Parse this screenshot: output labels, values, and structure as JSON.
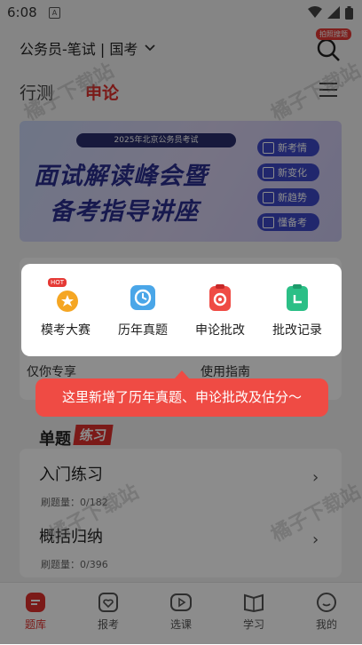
{
  "status": {
    "time": "6:08",
    "app_icon_letter": "A"
  },
  "header": {
    "exam_selector": "公务员-笔试 | 国考",
    "search_badge": "拍照搜题",
    "tabs": [
      "行测",
      "申论"
    ],
    "active_tab": "申论"
  },
  "banner": {
    "subtitle": "2025年北京公务员考试",
    "title_line1": "面试解读峰会暨",
    "title_line2": "备考指导讲座",
    "chips": [
      "新考情",
      "新变化",
      "新趋势",
      "懂备考"
    ]
  },
  "background": {
    "entry_left": "仅你专享",
    "entry_right": "使用指南",
    "section_title": "单题",
    "section_tag": "练习",
    "items": [
      {
        "title": "入门练习",
        "sub": "刷题量：0/182"
      },
      {
        "title": "概括归纳",
        "sub": "刷题量：0/396"
      }
    ]
  },
  "popup": {
    "features": [
      {
        "label": "模考大赛",
        "icon": "trophy-hot-icon",
        "badge": "HOT"
      },
      {
        "label": "历年真题",
        "icon": "history-icon"
      },
      {
        "label": "申论批改",
        "icon": "clipboard-check-icon"
      },
      {
        "label": "批改记录",
        "icon": "record-clock-icon"
      }
    ],
    "tooltip": "这里新增了历年真题、申论批改及估分～"
  },
  "nav": {
    "items": [
      {
        "label": "题库",
        "icon": "question-bank-icon"
      },
      {
        "label": "报考",
        "icon": "heart-doc-icon"
      },
      {
        "label": "选课",
        "icon": "play-icon"
      },
      {
        "label": "学习",
        "icon": "book-icon"
      },
      {
        "label": "我的",
        "icon": "profile-icon"
      }
    ],
    "active": "题库"
  },
  "watermark": "橘子下载站",
  "colors": {
    "accent": "#e0302c",
    "tooltip": "#ef4b44",
    "banner_text": "#2a2f8f"
  }
}
